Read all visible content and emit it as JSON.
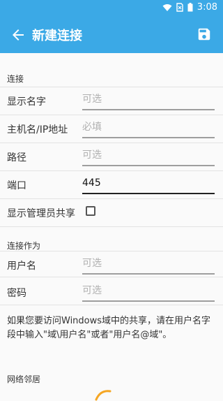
{
  "status_bar": {
    "time": "3:08"
  },
  "appbar": {
    "title": "新建连接",
    "back_icon": "arrow-left-icon",
    "save_icon": "save-icon"
  },
  "section_connection": {
    "header": "连接"
  },
  "fields": {
    "display_name": {
      "label": "显示名字",
      "placeholder": "可选",
      "value": ""
    },
    "host": {
      "label": "主机名/IP地址",
      "placeholder": "必填",
      "value": ""
    },
    "path": {
      "label": "路径",
      "placeholder": "可选",
      "value": ""
    },
    "port": {
      "label": "端口",
      "placeholder": "",
      "value": "445"
    },
    "show_admin_shares": {
      "label": "显示管理员共享",
      "checked": false
    }
  },
  "section_connect_as": {
    "header": "连接作为"
  },
  "auth": {
    "username": {
      "label": "用户名",
      "placeholder": "可选",
      "value": ""
    },
    "password": {
      "label": "密码",
      "placeholder": "可选",
      "value": ""
    }
  },
  "help_text": "如果您要访问Windows域中的共享，请在用户名字段中输入\"域\\用户名\"或者\"用户名@域\"。",
  "section_network": {
    "header": "网络邻居"
  },
  "colors": {
    "primary": "#3ba9e6",
    "spinner": "#f5a623"
  }
}
